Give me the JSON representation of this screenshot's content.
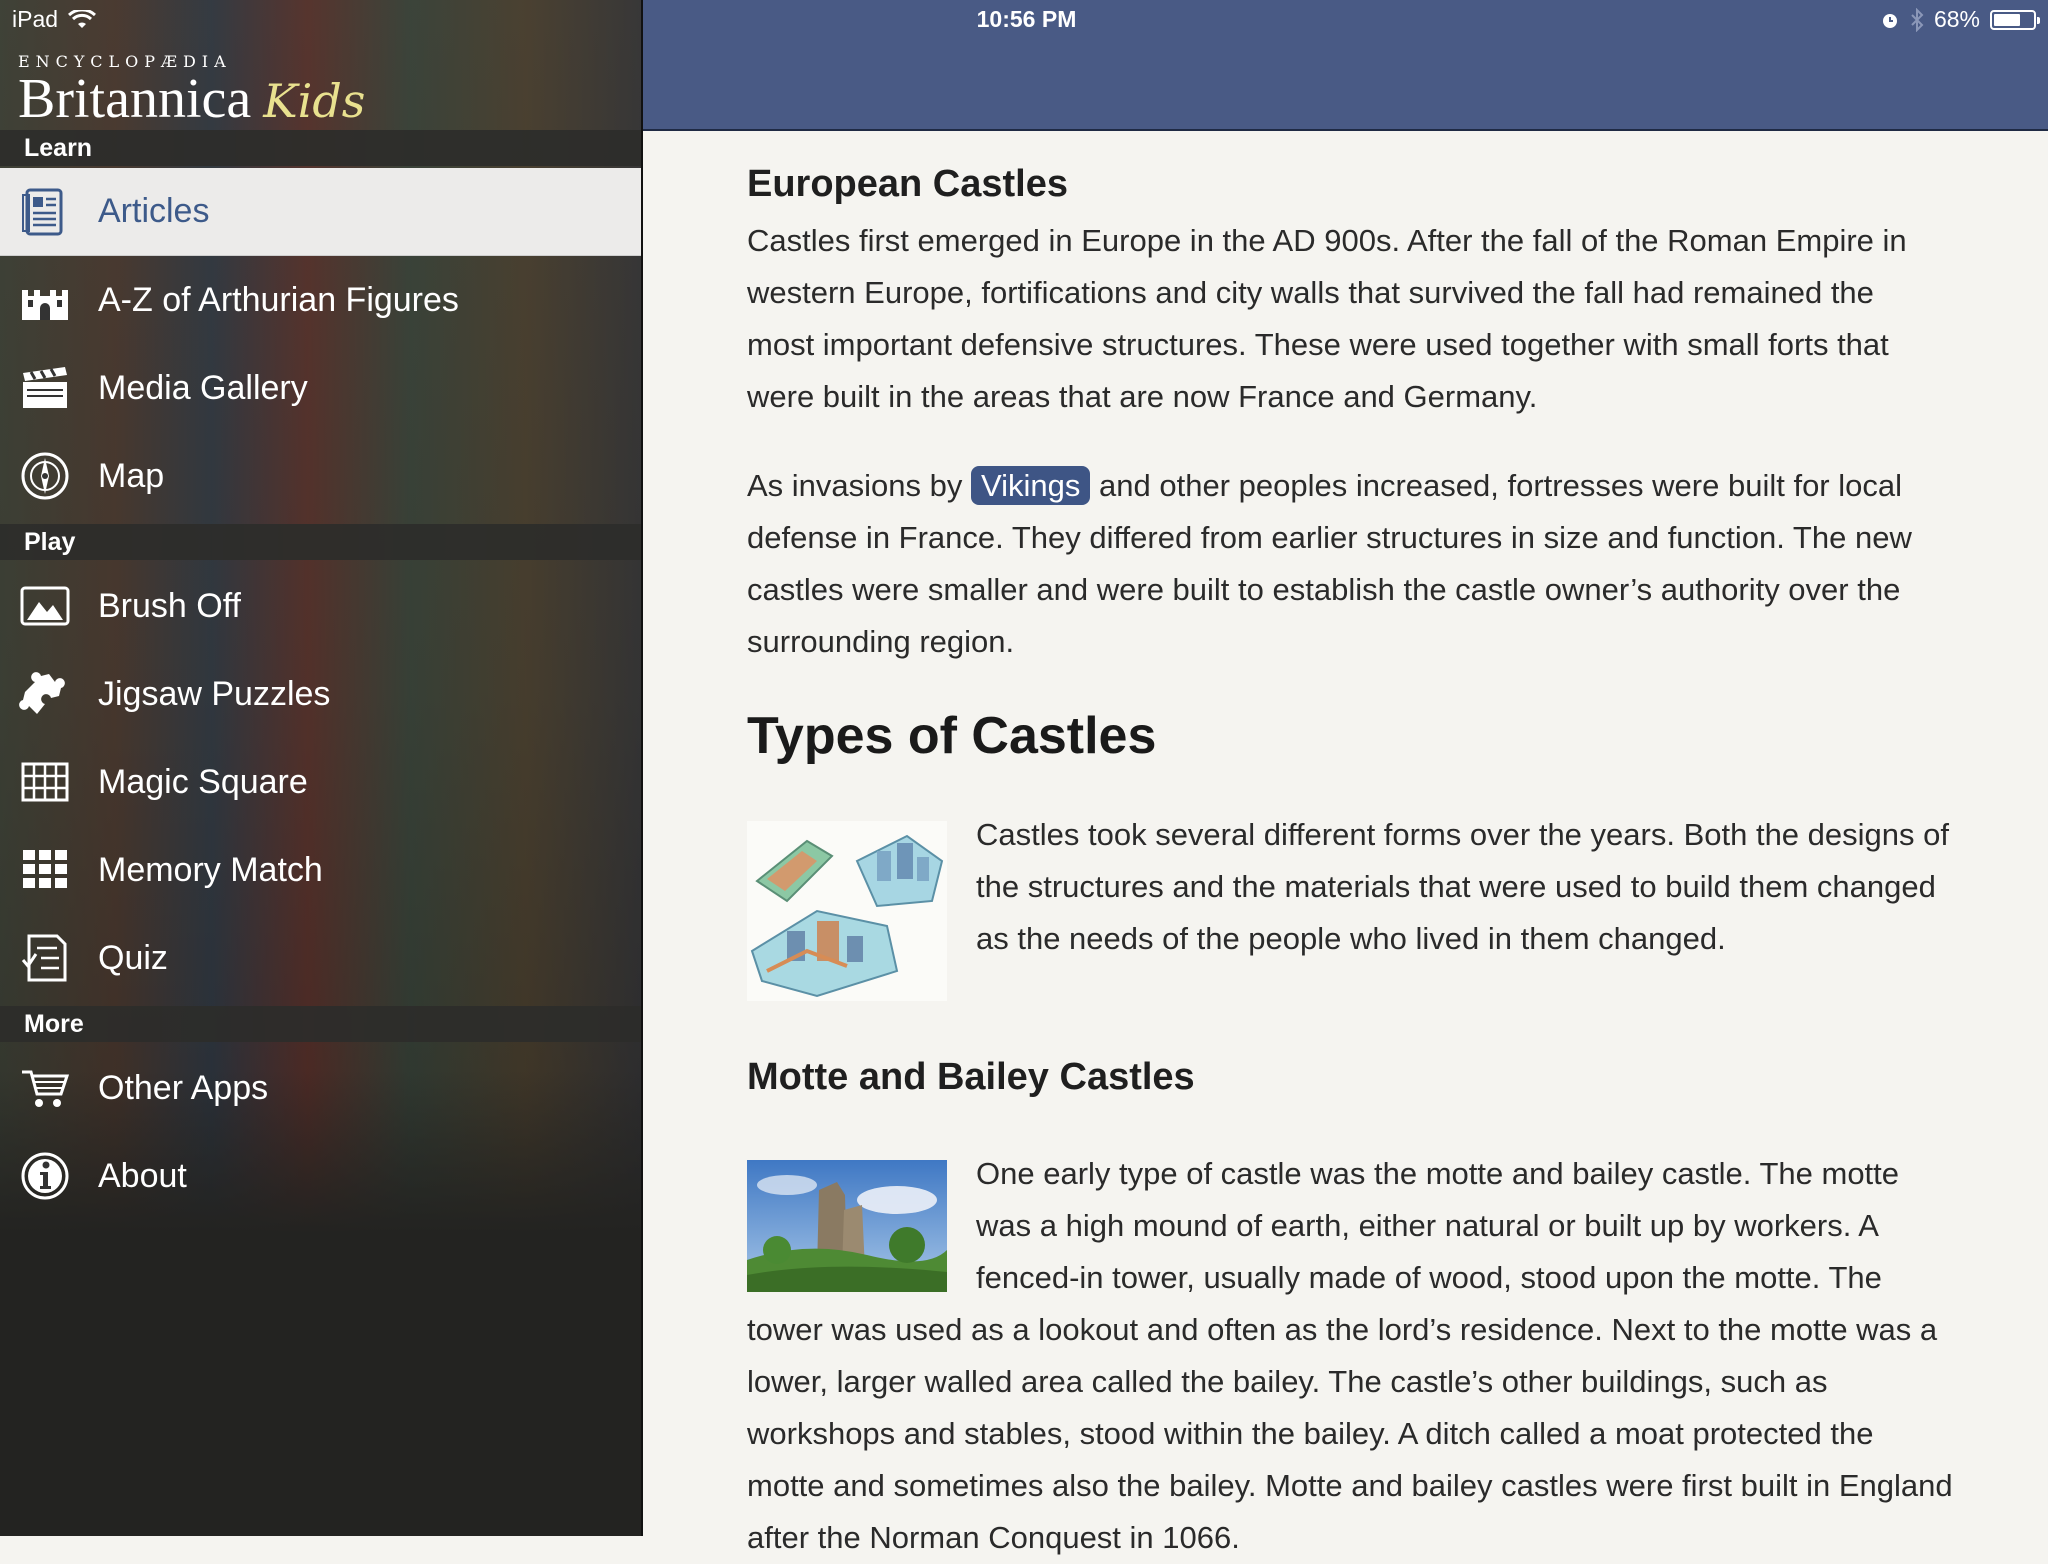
{
  "status": {
    "device": "iPad",
    "time": "10:56 PM",
    "battery": "68%",
    "battery_level": 0.68
  },
  "brand": {
    "top": "ENCYCLOPÆDIA",
    "name": "Britannica",
    "kids": "Kids"
  },
  "sidebar": {
    "sections": [
      {
        "label": "Learn"
      },
      {
        "label": "Play"
      },
      {
        "label": "More"
      }
    ],
    "items": [
      {
        "label": "Articles",
        "icon": "articles-icon"
      },
      {
        "label": "A-Z of Arthurian Figures",
        "icon": "castle-icon"
      },
      {
        "label": "Media Gallery",
        "icon": "clapperboard-icon"
      },
      {
        "label": "Map",
        "icon": "compass-icon"
      },
      {
        "label": "Brush Off",
        "icon": "picture-icon"
      },
      {
        "label": "Jigsaw Puzzles",
        "icon": "puzzle-icon"
      },
      {
        "label": "Magic Square",
        "icon": "grid-icon"
      },
      {
        "label": "Memory Match",
        "icon": "tiles-icon"
      },
      {
        "label": "Quiz",
        "icon": "quiz-icon"
      },
      {
        "label": "Other Apps",
        "icon": "cart-icon"
      },
      {
        "label": "About",
        "icon": "info-icon"
      }
    ]
  },
  "article": {
    "h_european": "European Castles",
    "p1": "Castles first emerged in Europe in the AD 900s. After the fall of the Roman Empire in western Europe, fortifications and city walls that survived the fall had remained the most important defensive structures. These were used together with small forts that were built in the areas that are now France and Germany.",
    "p2_before": "As invasions by",
    "p2_link": "Vikings",
    "p2_after": "and other peoples increased, fortresses were built for local defense in France. They differed from earlier structures in size and function. The new castles were smaller and were built to establish the castle owner’s authority over the surrounding region.",
    "h_types": "Types of Castles",
    "p3": "Castles took several different forms over the years. Both the designs of the structures and the materials that were used to build them changed as the needs of the people who lived in them changed.",
    "h_motte": "Motte and Bailey Castles",
    "p4": "One early type of castle was the motte and bailey castle. The motte was a high mound of earth, either natural or built up by workers. A fenced-in tower, usually made of wood, stood upon the motte. The tower was used as a lookout and often as the lord’s residence. Next to the motte was a lower, larger walled area called the bailey. The castle’s other buildings, such as workshops and stables, stood within the bailey. A ditch called a moat protected the motte and sometimes also the bailey. Motte and bailey castles were first built in England after the Norman Conquest in 1066."
  },
  "colors": {
    "topbar": "#495a85",
    "link_chip": "#3e5585",
    "active_label": "#3d5a8a",
    "kids": "#e9e18f"
  }
}
